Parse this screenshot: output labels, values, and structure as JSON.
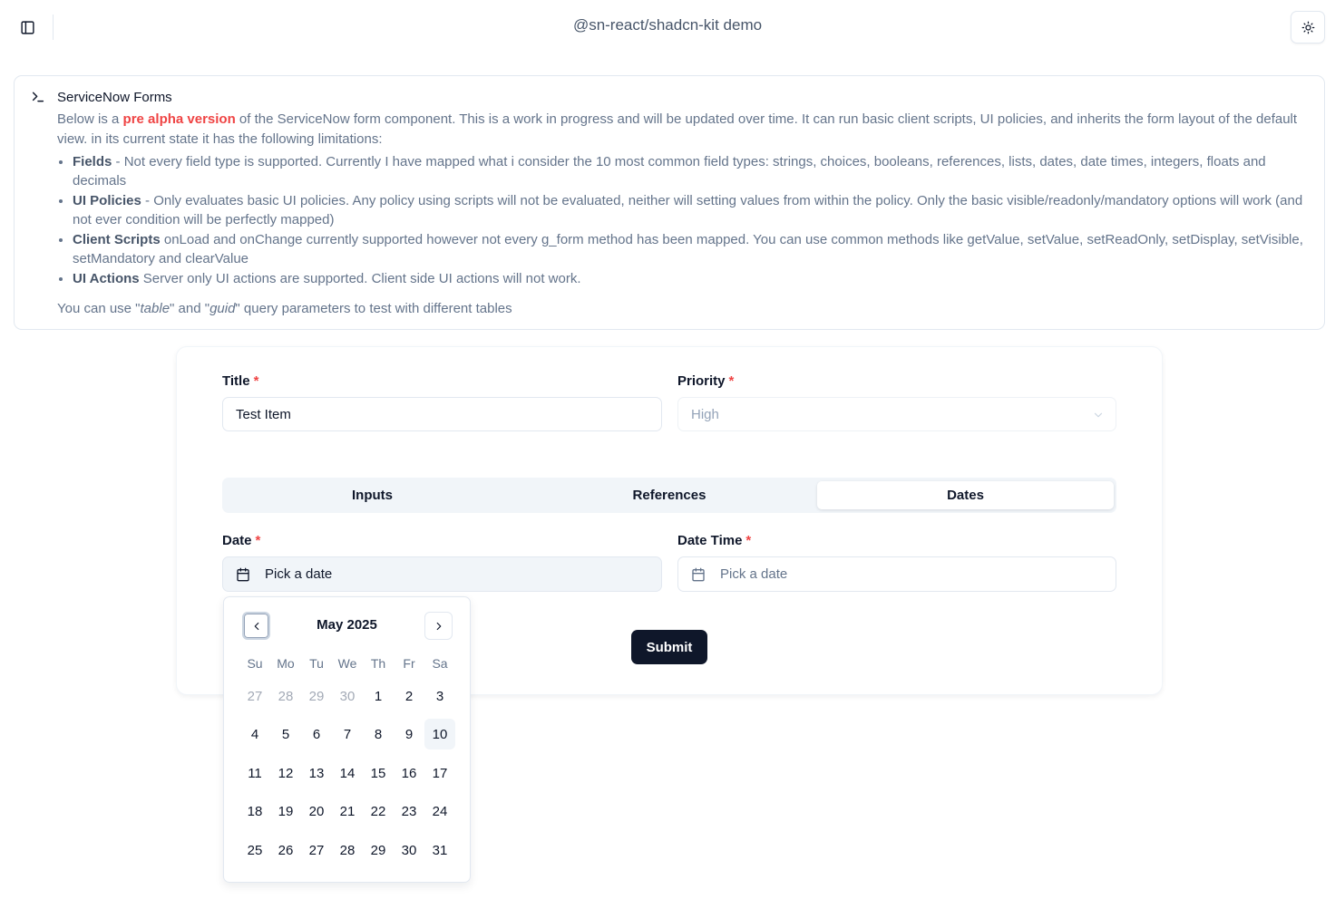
{
  "header": {
    "title": "@sn-react/shadcn-kit demo",
    "sidebar_icon": "panel-left-icon",
    "theme_icon": "sun-icon"
  },
  "alert": {
    "title": "ServiceNow Forms",
    "intro_before": "Below is a ",
    "intro_highlight": "pre alpha version",
    "intro_after": " of the ServiceNow form component. This is a work in progress and will be updated over time. It can run basic client scripts, UI policies, and inherits the form layout of the default view. in its current state it has the following limitations:",
    "items": [
      {
        "term": "Fields",
        "text": " - Not every field type is supported. Currently I have mapped what i consider the 10 most common field types: strings, choices, booleans, references, lists, dates, date times, integers, floats and decimals"
      },
      {
        "term": "UI Policies",
        "text": " - Only evaluates basic UI policies. Any policy using scripts will not be evaluated, neither will setting values from within the policy. Only the basic visible/readonly/mandatory options will work (and not ever condition will be perfectly mapped)"
      },
      {
        "term": "Client Scripts",
        "text": " onLoad and onChange currently supported however not every g_form method has been mapped. You can use common methods like getValue, setValue, setReadOnly, setDisplay, setVisible, setMandatory and clearValue"
      },
      {
        "term": "UI Actions",
        "text": " Server only UI actions are supported. Client side UI actions will not work."
      }
    ],
    "footer_1": "You can use \"",
    "footer_table": "table",
    "footer_2": "\" and \"",
    "footer_guid": "guid",
    "footer_3": "\" query parameters to test with different tables"
  },
  "form": {
    "title_label": "Title",
    "title_value": "Test Item",
    "priority_label": "Priority",
    "priority_value": "High",
    "required_mark": "*",
    "tabs": [
      {
        "label": "Inputs"
      },
      {
        "label": "References"
      },
      {
        "label": "Dates"
      }
    ],
    "active_tab": "Dates",
    "date_label": "Date",
    "date_placeholder": "Pick a date",
    "datetime_label": "Date Time",
    "datetime_placeholder": "Pick a date",
    "submit_label": "Submit"
  },
  "calendar": {
    "month_label": "May 2025",
    "weekdays": [
      "Su",
      "Mo",
      "Tu",
      "We",
      "Th",
      "Fr",
      "Sa"
    ],
    "weeks": [
      [
        "27",
        "28",
        "29",
        "30",
        "1",
        "2",
        "3"
      ],
      [
        "4",
        "5",
        "6",
        "7",
        "8",
        "9",
        "10"
      ],
      [
        "11",
        "12",
        "13",
        "14",
        "15",
        "16",
        "17"
      ],
      [
        "18",
        "19",
        "20",
        "21",
        "22",
        "23",
        "24"
      ],
      [
        "25",
        "26",
        "27",
        "28",
        "29",
        "30",
        "31"
      ]
    ],
    "outside_days": [
      "27",
      "28",
      "29",
      "30"
    ],
    "today": "10"
  },
  "colors": {
    "accent_red": "#ef4444",
    "primary": "#0f172a",
    "muted": "#64748b"
  }
}
